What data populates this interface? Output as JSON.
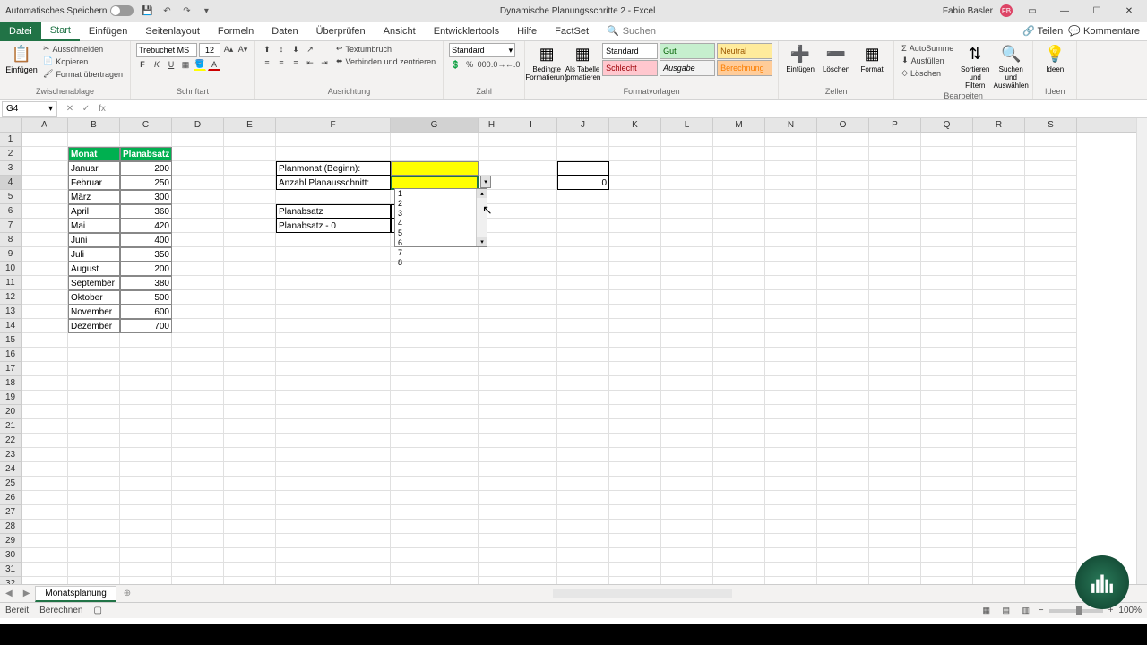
{
  "titlebar": {
    "autosave": "Automatisches Speichern",
    "doc_title": "Dynamische Planungsschritte 2  -  Excel",
    "user": "Fabio Basler",
    "user_initials": "FB"
  },
  "menu": {
    "file": "Datei",
    "tabs": [
      "Start",
      "Einfügen",
      "Seitenlayout",
      "Formeln",
      "Daten",
      "Überprüfen",
      "Ansicht",
      "Entwicklertools",
      "Hilfe",
      "FactSet"
    ],
    "search_placeholder": "Suchen",
    "share": "Teilen",
    "comments": "Kommentare"
  },
  "ribbon": {
    "clipboard": {
      "paste": "Einfügen",
      "cut": "Ausschneiden",
      "copy": "Kopieren",
      "format_painter": "Format übertragen",
      "label": "Zwischenablage"
    },
    "font": {
      "name": "Trebuchet MS",
      "size": "12",
      "label": "Schriftart"
    },
    "alignment": {
      "wrap": "Textumbruch",
      "merge": "Verbinden und zentrieren",
      "label": "Ausrichtung"
    },
    "number": {
      "format": "Standard",
      "label": "Zahl"
    },
    "styles": {
      "cond": "Bedingte\nFormatierung",
      "table": "Als Tabelle\nformatieren",
      "standard": "Standard",
      "schlecht": "Schlecht",
      "gut": "Gut",
      "ausgabe": "Ausgabe",
      "neutral": "Neutral",
      "berechnung": "Berechnung",
      "label": "Formatvorlagen"
    },
    "cells": {
      "insert": "Einfügen",
      "delete": "Löschen",
      "format": "Format",
      "label": "Zellen"
    },
    "editing": {
      "sum": "AutoSumme",
      "fill": "Ausfüllen",
      "clear": "Löschen",
      "sort": "Sortieren und\nFiltern",
      "find": "Suchen und\nAuswählen",
      "label": "Bearbeiten"
    },
    "ideas": {
      "label": "Ideen"
    }
  },
  "formula": {
    "name_box": "G4",
    "fx": "fx"
  },
  "cols": [
    "A",
    "B",
    "C",
    "D",
    "E",
    "F",
    "G",
    "H",
    "I",
    "J",
    "K",
    "L",
    "M",
    "N",
    "O",
    "P",
    "Q",
    "R",
    "S"
  ],
  "table": {
    "h1": "Monat",
    "h2": "Planabsatz",
    "rows": [
      {
        "m": "Januar",
        "v": "200"
      },
      {
        "m": "Februar",
        "v": "250"
      },
      {
        "m": "März",
        "v": "300"
      },
      {
        "m": "April",
        "v": "360"
      },
      {
        "m": "Mai",
        "v": "420"
      },
      {
        "m": "Juni",
        "v": "400"
      },
      {
        "m": "Juli",
        "v": "350"
      },
      {
        "m": "August",
        "v": "200"
      },
      {
        "m": "September",
        "v": "380"
      },
      {
        "m": "Oktober",
        "v": "500"
      },
      {
        "m": "November",
        "v": "600"
      },
      {
        "m": "Dezember",
        "v": "700"
      }
    ]
  },
  "form": {
    "planmonat": "Planmonat (Beginn):",
    "anzahl": "Anzahl Planausschnitt:",
    "planabsatz": "Planabsatz",
    "planabsatz_minus": "Planabsatz  - 0",
    "j4": "0"
  },
  "dropdown": {
    "opts": [
      "1",
      "2",
      "3",
      "4",
      "5",
      "6",
      "7",
      "8"
    ]
  },
  "sheet": {
    "name": "Monatsplanung"
  },
  "status": {
    "ready": "Bereit",
    "calc": "Berechnen",
    "zoom": "100%"
  }
}
